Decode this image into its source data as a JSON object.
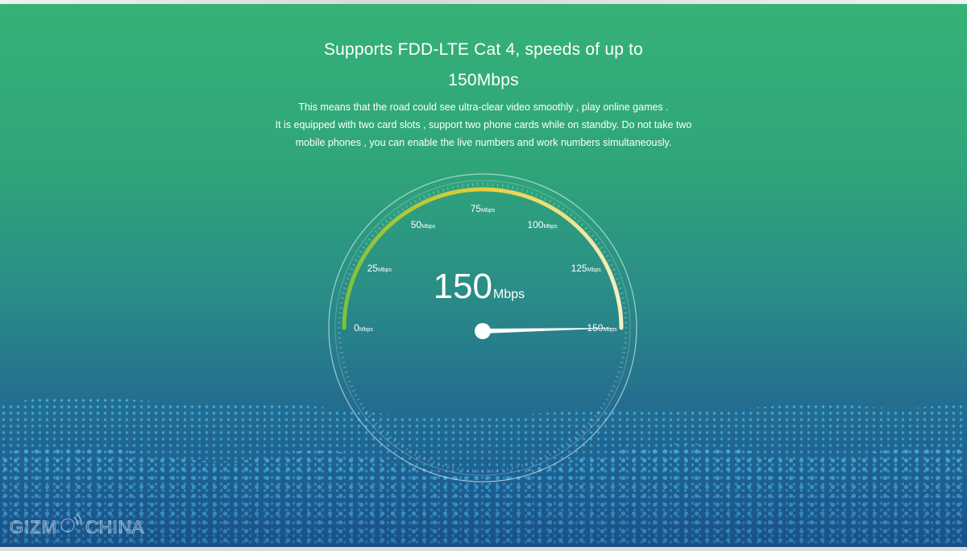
{
  "headline": {
    "line1": "Supports FDD-LTE Cat 4, speeds of up to",
    "line2": "150Mbps"
  },
  "body": {
    "line1": "This means that the road could see ultra-clear video smoothly , play online games .",
    "line2": "It is equipped with two card slots , support two phone cards while on standby. Do not take two",
    "line3": "mobile phones , you can enable the live numbers and work numbers simultaneously."
  },
  "speedometer": {
    "readout_value": "150",
    "readout_unit": "Mbps",
    "needle_value": 150,
    "min": 0,
    "max": 150,
    "ticks": [
      {
        "value": "0",
        "unit": "Mbps"
      },
      {
        "value": "25",
        "unit": "Mbps"
      },
      {
        "value": "50",
        "unit": "Mbps"
      },
      {
        "value": "75",
        "unit": "Mbps"
      },
      {
        "value": "100",
        "unit": "Mbps"
      },
      {
        "value": "125",
        "unit": "Mbps"
      },
      {
        "value": "150",
        "unit": "Mbps"
      }
    ],
    "arc_colors": [
      "#7cc23c",
      "#e8cf3a",
      "#f3f0c2"
    ]
  },
  "watermark": {
    "text_left": "GIZM",
    "text_right": "CHINA",
    "icon": "wifi-signal-icon"
  },
  "colors": {
    "background_top": "#35b276",
    "background_bottom": "#1f5e92",
    "wave_dots": "#3db8f0"
  }
}
